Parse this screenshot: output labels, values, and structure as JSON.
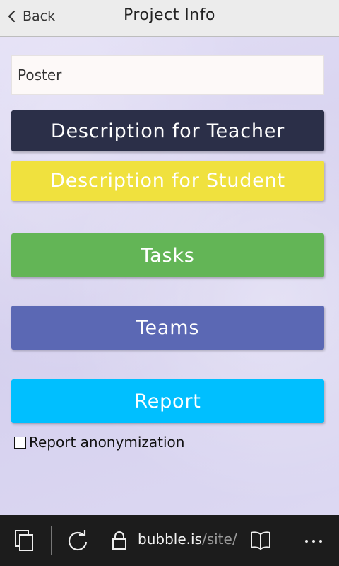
{
  "header": {
    "back_label": "Back",
    "title": "Project Info"
  },
  "form": {
    "project_name_value": "Poster"
  },
  "buttons": {
    "teacher": "Description for Teacher",
    "student": "Description for Student",
    "tasks": "Tasks",
    "teams": "Teams",
    "report": "Report"
  },
  "checkbox": {
    "label": "Report anonymization",
    "checked": false
  },
  "browser": {
    "url_host": "bubble.is",
    "url_path": "/site/",
    "icons": [
      "tabs-icon",
      "refresh-icon",
      "lock-icon",
      "reading-view-icon",
      "more-icon"
    ]
  },
  "colors": {
    "teacher_button": "#2b2f48",
    "student_button": "#f0e13e",
    "tasks_button": "#63b556",
    "teams_button": "#5b68b4",
    "report_button": "#00bfff"
  }
}
